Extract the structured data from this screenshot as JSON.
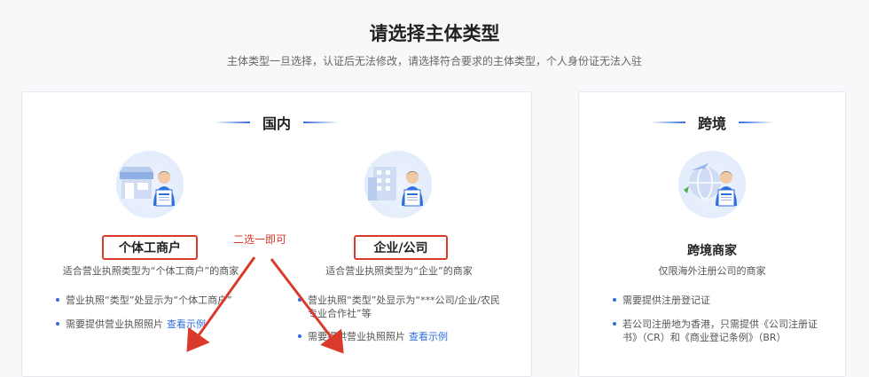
{
  "page": {
    "title": "请选择主体类型",
    "subtitle": "主体类型一旦选择，认证后无法修改，请选择符合要求的主体类型，个人身份证无法入驻"
  },
  "domestic": {
    "section_title": "国内",
    "individual": {
      "label": "个体工商户",
      "desc": "适合营业执照类型为“个体工商户”的商家",
      "bullet1": "营业执照“类型”处显示为“个体工商户”",
      "bullet2": "需要提供营业执照照片",
      "example_link": "查看示例"
    },
    "enterprise": {
      "label": "企业/公司",
      "desc": "适合营业执照类型为“企业”的商家",
      "bullet1_line1": "营业执照“类型”处显示为“***公司/企业/农民",
      "bullet1_line2": "专业合作社”等",
      "bullet2": "需要提供营业执照照片",
      "example_link": "查看示例"
    }
  },
  "cross_border": {
    "section_title": "跨境",
    "merchant": {
      "label": "跨境商家",
      "desc": "仅限海外注册公司的商家",
      "bullet1": "需要提供注册登记证",
      "bullet2_line1": "若公司注册地为香港，只需提供《公司注册证",
      "bullet2_line2": "书》（CR）和《商业登记条例》（BR）"
    }
  },
  "annotation": "二选一即可",
  "colors": {
    "accent_blue": "#2f6fdc",
    "highlight_red": "#d93a2b",
    "card_bg": "#ffffff",
    "page_bg": "#f7f8fa"
  },
  "icons": {
    "individual": "storefront-illustration-icon",
    "enterprise": "office-building-illustration-icon",
    "cross_border": "globe-plane-illustration-icon"
  }
}
